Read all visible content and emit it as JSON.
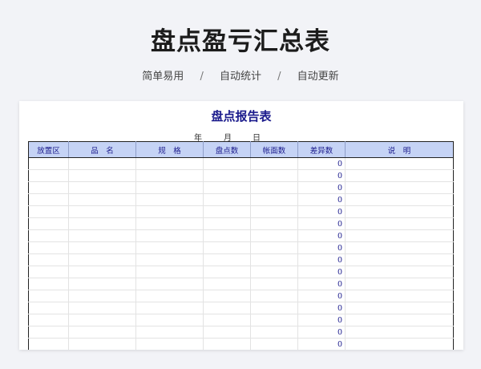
{
  "page": {
    "title": "盘点盈亏汇总表",
    "features": [
      "简单易用",
      "自动统计",
      "自动更新"
    ],
    "separator": "/"
  },
  "report": {
    "title": "盘点报告表",
    "date": {
      "year": "年",
      "month": "月",
      "day": "日"
    },
    "columns": [
      "放置区",
      "品　名",
      "规　格",
      "盘点数",
      "帐面数",
      "差异数",
      "说　明"
    ],
    "rows": [
      {
        "diff": "0"
      },
      {
        "diff": "0"
      },
      {
        "diff": "0"
      },
      {
        "diff": "0"
      },
      {
        "diff": "0"
      },
      {
        "diff": "0"
      },
      {
        "diff": "0"
      },
      {
        "diff": "0"
      },
      {
        "diff": "0"
      },
      {
        "diff": "0"
      },
      {
        "diff": "0"
      },
      {
        "diff": "0"
      },
      {
        "diff": "0"
      },
      {
        "diff": "0"
      },
      {
        "diff": "0"
      },
      {
        "diff": "0"
      }
    ]
  },
  "colors": {
    "header_fill": "#c5d3f5",
    "header_text": "#1a1a8c",
    "page_background": "#f2f3f7"
  }
}
